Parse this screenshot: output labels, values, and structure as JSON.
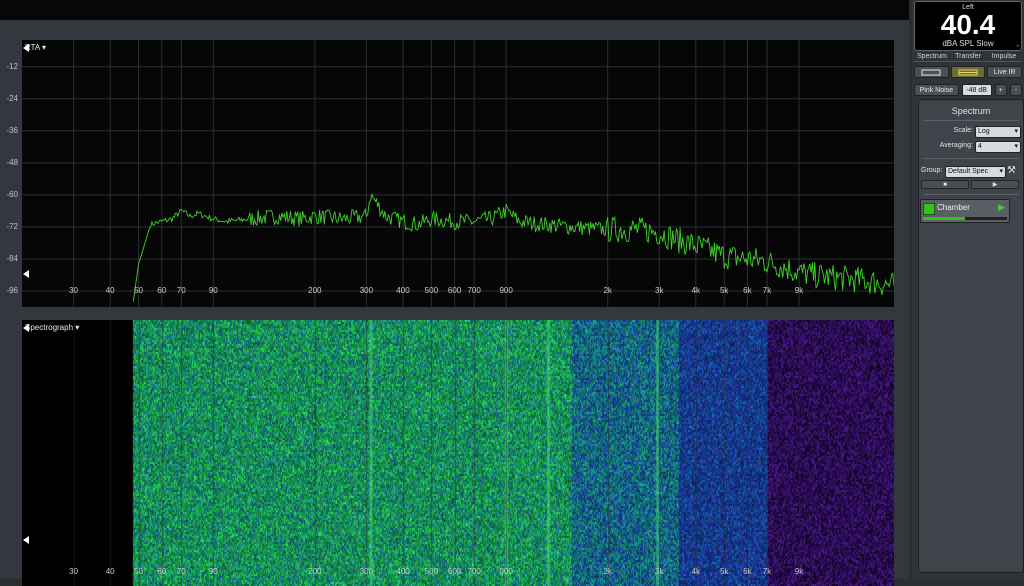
{
  "rta": {
    "title": "RTA ▾",
    "y_ticks": [
      "-12",
      "-24",
      "-36",
      "-48",
      "-60",
      "-72",
      "-84",
      "-96"
    ],
    "y_values": [
      -12,
      -24,
      -36,
      -48,
      -60,
      -72,
      -84,
      -96
    ],
    "ylim": [
      -2,
      -102
    ]
  },
  "spectrograph": {
    "title": "Spectrograph ▾"
  },
  "x_axis": {
    "freqs": [
      30,
      40,
      50,
      60,
      70,
      90,
      200,
      300,
      400,
      500,
      600,
      700,
      900,
      2000,
      3000,
      4000,
      5000,
      6000,
      7000,
      9000
    ],
    "labels": [
      "30",
      "40",
      "50",
      "60",
      "70",
      "90",
      "200",
      "300",
      "400",
      "500",
      "600",
      "700",
      "900",
      "2k",
      "3k",
      "4k",
      "5k",
      "6k",
      "7k",
      "9k"
    ],
    "xlim": [
      20,
      19000
    ]
  },
  "meter": {
    "channel": "Left",
    "value": "40.4",
    "unit": "dBA SPL Slow",
    "collapse": "-"
  },
  "tabs": [
    "Spectrum",
    "Transfer",
    "Impulse"
  ],
  "live_ir_label": "Live IR",
  "pink_noise": {
    "label": "Pink Noise",
    "level": "-48 dB",
    "plus": "+",
    "minus": "-"
  },
  "spectrum_panel": {
    "heading": "Spectrum",
    "scale_label": "Scale:",
    "scale_value": "Log",
    "averaging_label": "Averaging:",
    "averaging_value": "4",
    "group_label": "Group:",
    "group_value": "Default Spec",
    "stop_symbol": "■",
    "play_symbol": "▶",
    "measurement": "Chamber",
    "measurement_color": "#35c21f"
  },
  "colors": {
    "trace": "#3fd12a"
  },
  "chart_data": {
    "type": "line",
    "x": [
      48,
      50,
      55,
      60,
      65,
      70,
      75,
      80,
      90,
      100,
      120,
      150,
      180,
      200,
      250,
      300,
      310,
      350,
      400,
      450,
      500,
      600,
      700,
      800,
      900,
      1000,
      1200,
      1500,
      2000,
      2500,
      3000,
      3500,
      4000,
      4500,
      5000,
      6000,
      7000,
      8000,
      9000,
      10000,
      12000,
      15000,
      19000
    ],
    "y": [
      -100,
      -86,
      -71,
      -70,
      -69,
      -66,
      -68,
      -67,
      -69,
      -70,
      -69,
      -68,
      -69,
      -68,
      -69,
      -68,
      -60,
      -68,
      -70,
      -71,
      -69,
      -70,
      -70,
      -69,
      -66,
      -70,
      -71,
      -72,
      -73,
      -73,
      -74,
      -77,
      -79,
      -81,
      -83,
      -84,
      -85,
      -87,
      -89,
      -90,
      -91,
      -92,
      -94
    ],
    "xscale": "log",
    "xlim": [
      20,
      19000
    ],
    "ylim": [
      -2,
      -102
    ],
    "series": [
      {
        "name": "Chamber"
      }
    ]
  }
}
